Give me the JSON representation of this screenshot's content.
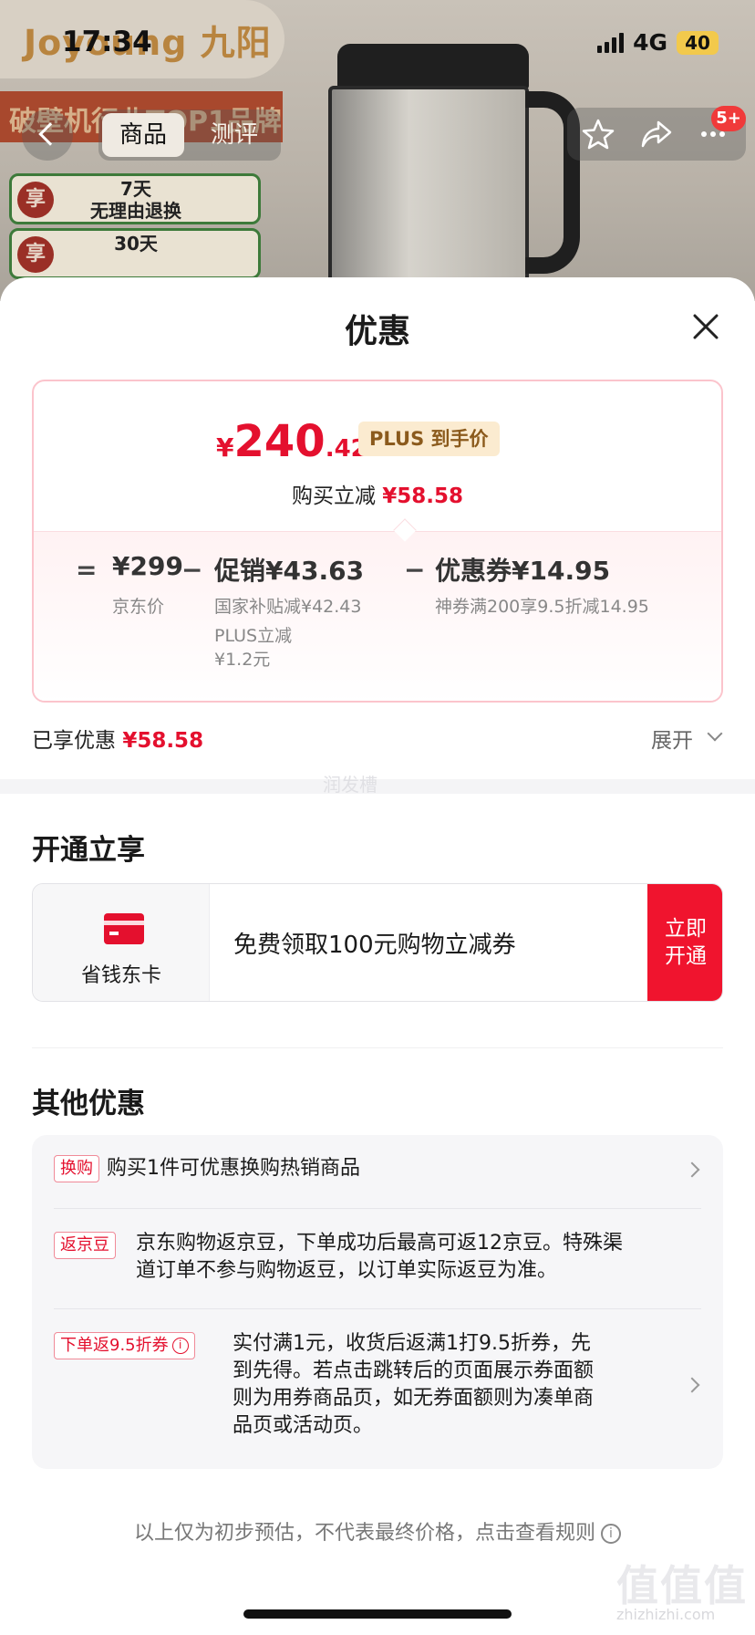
{
  "status_bar": {
    "time": "17:34",
    "network": "4G",
    "battery": "40"
  },
  "product": {
    "brand": "Joyoung 九阳",
    "banner": "破壁机行业TOP1品牌",
    "promo_tags": [
      {
        "badge": "享",
        "line1": "7天",
        "line2": "无理由退换"
      },
      {
        "badge": "享",
        "line1": "30天",
        "line2": ""
      }
    ]
  },
  "nav": {
    "tabs": [
      "商品",
      "测评"
    ],
    "active_tab": "商品",
    "cart_badge": "5+"
  },
  "sheet": {
    "title": "优惠",
    "price": {
      "currency": "¥",
      "integer": "240",
      "decimal": ".42",
      "badge": "PLUS 到手价",
      "reduce_label": "购买立减",
      "reduce_amount": "¥58.58"
    },
    "breakdown": {
      "eq": "=",
      "minus": "−",
      "base_price": "¥299",
      "base_label": "京东价",
      "promo_label": "促销",
      "promo_amount": "¥43.63",
      "promo_detail_1": "国家补贴减¥42.43",
      "promo_detail_2": "PLUS立减",
      "promo_detail_3": "¥1.2元",
      "coupon_label": "优惠券",
      "coupon_amount": "¥14.95",
      "coupon_detail": "神券满200享9.5折减14.95"
    },
    "enjoyed_label": "已享优惠",
    "enjoyed_amount": "¥58.58",
    "expand_label": "展开",
    "watermark": "润发槽",
    "open_section": {
      "title": "开通立享",
      "card_name": "省钱东卡",
      "description": "免费领取100元购物立减券",
      "button_line1": "立即",
      "button_line2": "开通"
    },
    "other_section": {
      "title": "其他优惠",
      "items": [
        {
          "tag": "换购",
          "text": "购买1件可优惠换购热销商品"
        },
        {
          "tag": "返京豆",
          "text_line1": "京东购物返京豆，下单成功后最高可返12京豆。特殊渠",
          "text_line2": "道订单不参与购物返豆，以订单实际返豆为准。"
        },
        {
          "tag": "下单返9.5折券",
          "text_line1": "实付满1元，收货后返满1打9.5折券，先",
          "text_line2": "到先得。若点击跳转后的页面展示券面额",
          "text_line3": "则为用券商品页，如无券面额则为凑单商",
          "text_line4": "品页或活动页。"
        }
      ]
    },
    "disclaimer": "以上仅为初步预估，不代表最终价格，点击查看规则"
  },
  "corner_watermark": {
    "mark": "值值值",
    "site": "zhizhizhi.com"
  },
  "colors": {
    "accent_red": "#e4102e",
    "plus_gold": "#8b5a1c"
  }
}
